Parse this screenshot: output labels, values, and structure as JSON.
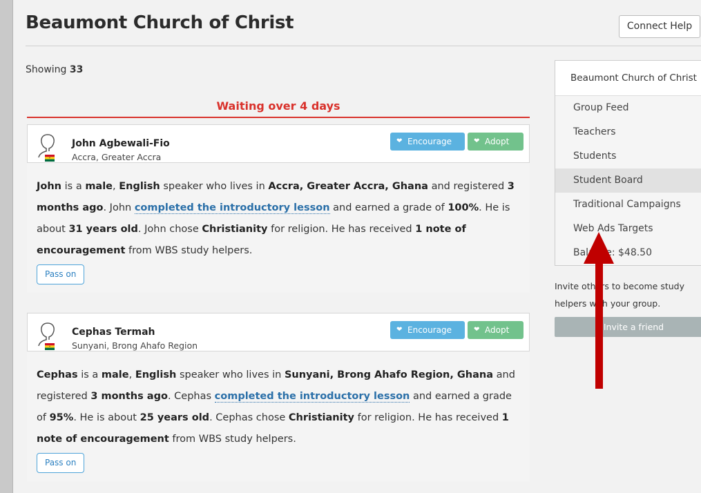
{
  "header": {
    "title": "Beaumont Church of Christ",
    "help_button": "Connect Help"
  },
  "feed": {
    "showing_label": "Showing",
    "showing_count": "33",
    "section_heading": "Waiting over 4 days",
    "students": [
      {
        "name": "John Agbewali-Fio",
        "location": "Accra, Greater Accra",
        "encourage_label": "Encourage",
        "adopt_label": "Adopt",
        "pass_label": "Pass on",
        "body": {
          "first_name": "John",
          "gender": "male",
          "language": "English",
          "full_location": "Accra, Greater Accra, Ghana",
          "registered": "3 months ago",
          "first_name2": "John",
          "lesson_link": "completed the introductory lesson",
          "grade": "100%",
          "age": "31 years old",
          "first_name3": "John",
          "religion": "Christianity",
          "notes": "1 note of encouragement"
        }
      },
      {
        "name": "Cephas Termah",
        "location": "Sunyani, Brong Ahafo Region",
        "encourage_label": "Encourage",
        "adopt_label": "Adopt",
        "pass_label": "Pass on",
        "body": {
          "first_name": "Cephas",
          "gender": "male",
          "language": "English",
          "full_location": "Sunyani, Brong Ahafo Region, Ghana",
          "registered": "3 months ago",
          "first_name2": "Cephas",
          "lesson_link": "completed the introductory lesson",
          "grade": "95%",
          "age": "25 years old",
          "first_name3": "Cephas",
          "religion": "Christianity",
          "notes": "1 note of encouragement"
        }
      }
    ],
    "phrases": {
      "is_a": "is a",
      "comma_sp": ",",
      "speaker_lives": "speaker who lives in",
      "and_registered": "and registered",
      "period": ".",
      "and_earned": "and earned a grade of",
      "he_is_about": "He is about",
      "chose": "chose",
      "for_religion": "for religion. He has received",
      "from_helpers": "from WBS study helpers."
    }
  },
  "sidebar": {
    "title": "Beaumont Church of Christ",
    "items": [
      {
        "label": "Group Feed"
      },
      {
        "label": "Teachers"
      },
      {
        "label": "Students"
      },
      {
        "label": "Student Board"
      },
      {
        "label": "Traditional Campaigns"
      },
      {
        "label": "Web Ads Targets"
      },
      {
        "label": "Balance: $48.50"
      }
    ],
    "active_item": "Student Board",
    "invite_text": "Invite others to become study helpers with your group.",
    "invite_button": "Invite a friend"
  },
  "colors": {
    "accent_red": "#d9312b",
    "encourage_blue": "#5bb2e0",
    "adopt_green": "#72c28c",
    "link_blue": "#2a6fa8",
    "annotation_arrow": "#c00000"
  },
  "icons": [
    "user-outline-icon",
    "ghana-flag-icon",
    "heart-icon"
  ]
}
